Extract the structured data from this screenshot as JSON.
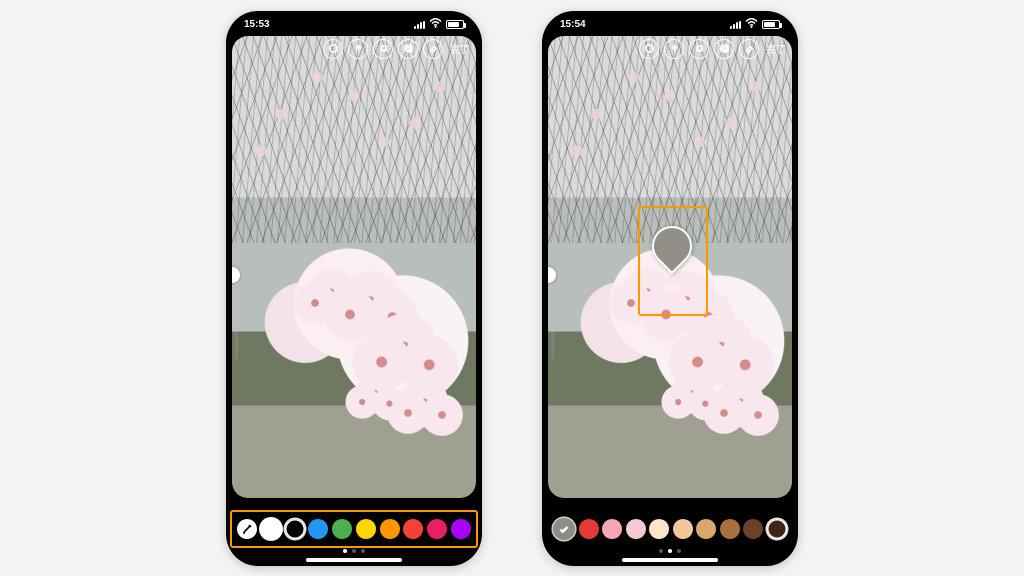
{
  "screens": [
    {
      "status": {
        "time": "15:53"
      },
      "topbar": {
        "done_label": "完了"
      },
      "palette": {
        "leading": "eyedropper",
        "colors": [
          {
            "name": "white",
            "value": "#ffffff",
            "ring": true,
            "selected": true
          },
          {
            "name": "black",
            "value": "#000000",
            "ring": true
          },
          {
            "name": "blue",
            "value": "#2196f3"
          },
          {
            "name": "green",
            "value": "#4caf50"
          },
          {
            "name": "yellow",
            "value": "#ffd600"
          },
          {
            "name": "orange",
            "value": "#ff9800"
          },
          {
            "name": "red",
            "value": "#f44336"
          },
          {
            "name": "pink",
            "value": "#ea1e63"
          },
          {
            "name": "magenta",
            "value": "#aa00ff"
          }
        ],
        "page_active": 0
      }
    },
    {
      "status": {
        "time": "15:54"
      },
      "topbar": {
        "done_label": "完了"
      },
      "dropper_preview": {
        "sampled_color": "#928f89"
      },
      "palette": {
        "leading": "confirm",
        "colors": [
          {
            "name": "red",
            "value": "#e53935"
          },
          {
            "name": "light-pink",
            "value": "#f6a6b4"
          },
          {
            "name": "pale-pink",
            "value": "#f5c9cf"
          },
          {
            "name": "cream",
            "value": "#fbe5c9"
          },
          {
            "name": "peach",
            "value": "#f3c69c"
          },
          {
            "name": "tan",
            "value": "#dba76f"
          },
          {
            "name": "brown",
            "value": "#a8713f"
          },
          {
            "name": "dark-brown",
            "value": "#6b4227"
          },
          {
            "name": "deep-brown",
            "value": "#3f2716",
            "ring": true
          }
        ],
        "page_active": 1
      }
    }
  ]
}
